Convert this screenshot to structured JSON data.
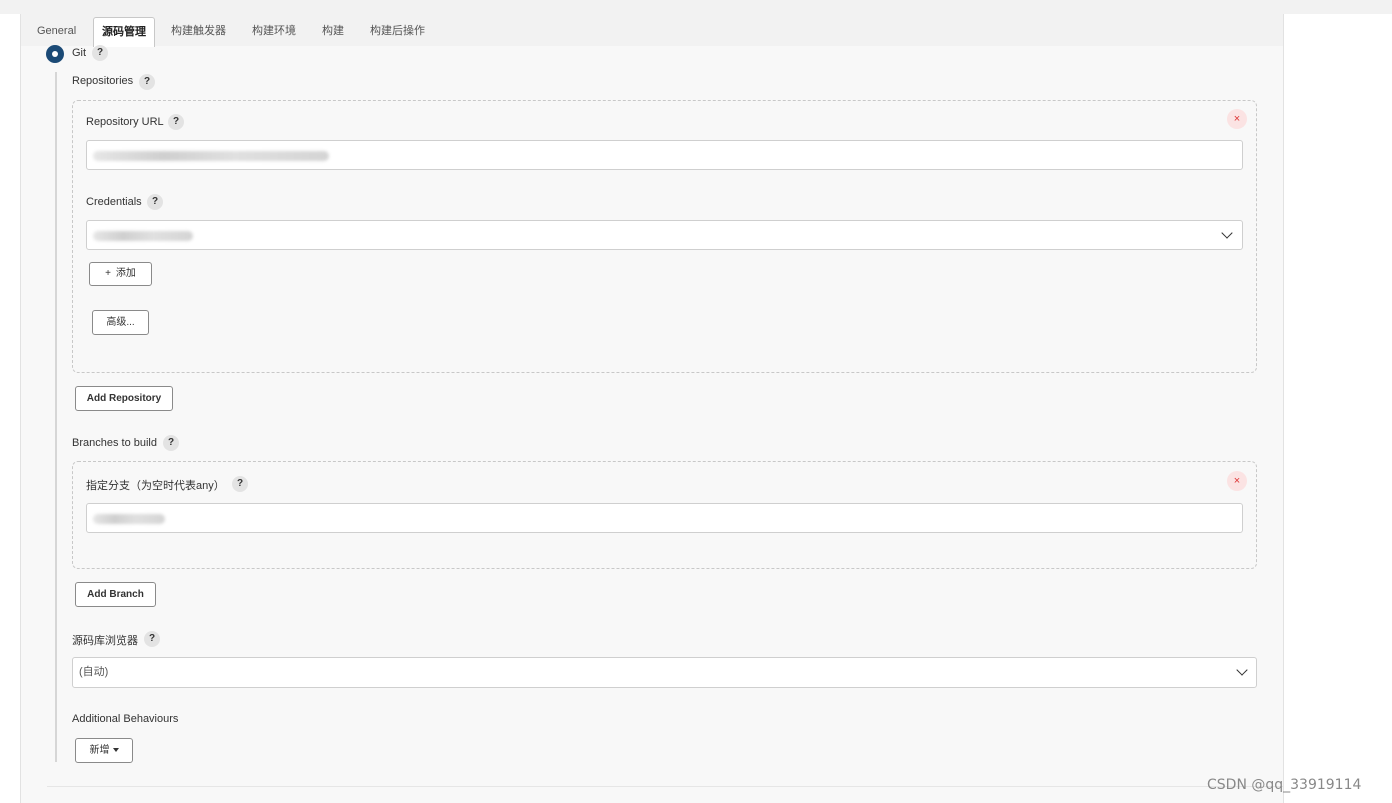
{
  "tabs": [
    "General",
    "源码管理",
    "构建触发器",
    "构建环境",
    "构建",
    "构建后操作"
  ],
  "scm": {
    "git_label": "Git",
    "help": "?",
    "repositories_label": "Repositories",
    "repository_url_label": "Repository URL",
    "credentials_label": "Credentials",
    "add_button": "添加",
    "add_icon": "+",
    "advanced_button": "高级...",
    "add_repository_button": "Add Repository",
    "branches_label": "Branches to build",
    "branch_specifier_label": "指定分支（为空时代表any）",
    "add_branch_button": "Add Branch",
    "browser_label": "源码库浏览器",
    "browser_value": "(自动)",
    "additional_label": "Additional Behaviours",
    "new_button": "新增",
    "delete_symbol": "×"
  },
  "icons": {
    "delete": "close-icon",
    "dropdown": "chevron-down-icon",
    "help": "help-icon"
  },
  "colors": {
    "accent": "#1b4a76",
    "delete_bg": "#fbe3e3",
    "delete_fg": "#d33333"
  },
  "watermark": "CSDN @qq_33919114"
}
